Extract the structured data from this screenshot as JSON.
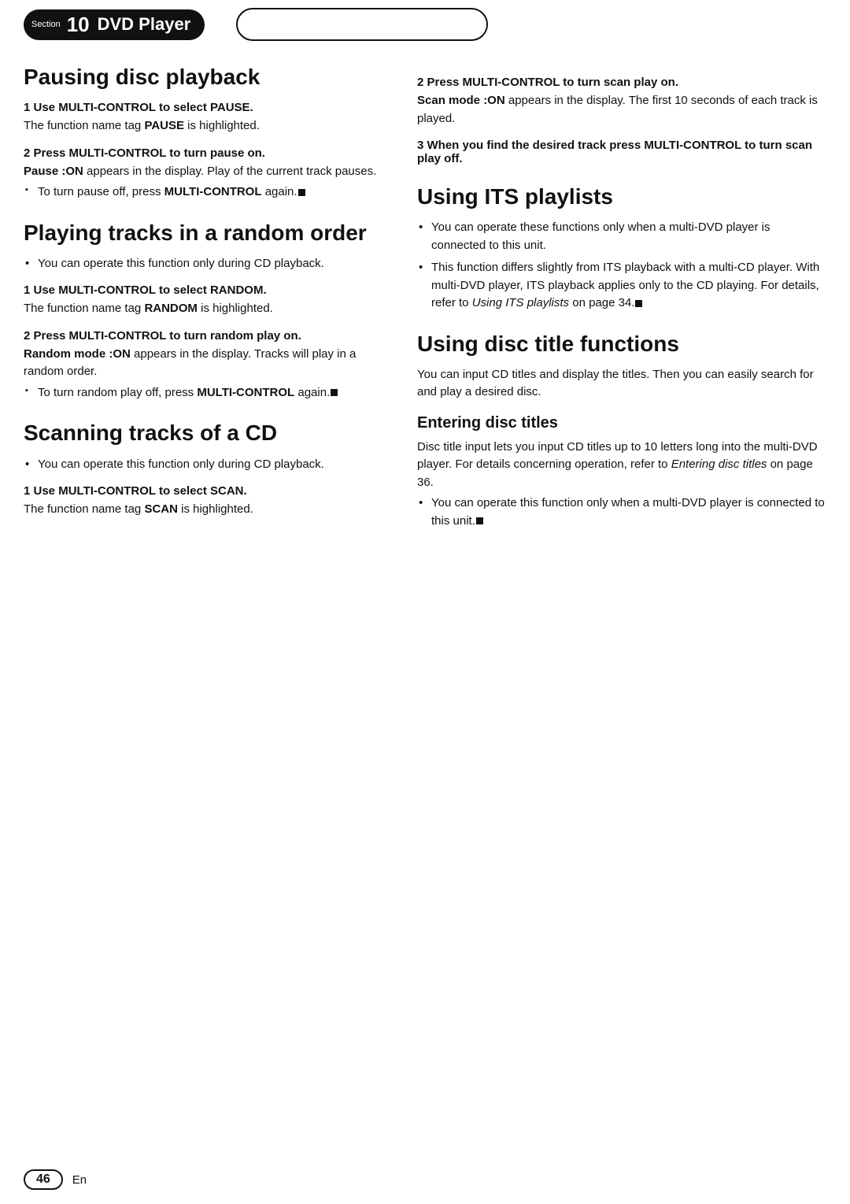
{
  "header": {
    "section_label": "Section",
    "section_number": "10",
    "section_title": "DVD Player"
  },
  "page_number": "46",
  "page_lang": "En",
  "left_col": {
    "pausing": {
      "title": "Pausing disc playback",
      "step1_heading": "1   Use MULTI-CONTROL to select PAUSE.",
      "step1_body": "The function name tag ",
      "step1_bold": "PAUSE",
      "step1_body2": " is highlighted.",
      "step2_heading": "2   Press MULTI-CONTROL to turn pause on.",
      "step2_body1_pre": "",
      "step2_pause_on": "Pause :ON",
      "step2_body1_post": " appears in the display. Play of the current track pauses.",
      "step2_arrow": "To turn pause off, press ",
      "step2_arrow_bold": "MULTI-CONTROL",
      "step2_arrow_post": " again."
    },
    "random": {
      "title": "Playing tracks in a random order",
      "bullets": [
        "You can operate this function only during CD playback."
      ],
      "step1_heading": "1   Use MULTI-CONTROL to select RANDOM.",
      "step1_body_pre": "The function name tag ",
      "step1_body_bold": "RANDOM",
      "step1_body_post": " is highlighted.",
      "step2_heading": "2   Press MULTI-CONTROL to turn random play on.",
      "step2_body1_pre": "",
      "step2_random_on": "Random mode :ON",
      "step2_body1_post": " appears in the display. Tracks will play in a random order.",
      "step2_arrow": "To turn random play off, press ",
      "step2_arrow_bold": "MULTI-CONTROL",
      "step2_arrow_post": " again."
    },
    "scanning": {
      "title": "Scanning tracks of a CD",
      "bullets": [
        "You can operate this function only during CD playback."
      ],
      "step1_heading": "1   Use MULTI-CONTROL to select SCAN.",
      "step1_body_pre": "The function name tag ",
      "step1_body_bold": "SCAN",
      "step1_body_post": " is highlighted."
    }
  },
  "right_col": {
    "scan_continued": {
      "step2_heading": "2   Press MULTI-CONTROL to turn scan play on.",
      "step2_body1_pre": "",
      "step2_scan_on": "Scan mode :ON",
      "step2_body1_post": " appears in the display. The first 10 seconds of each track is played.",
      "step3_heading": "3   When you find the desired track press MULTI-CONTROL to turn scan play off."
    },
    "its": {
      "title": "Using ITS playlists",
      "bullets": [
        "You can operate these functions only when a multi-DVD player is connected to this unit.",
        "This function differs slightly from ITS playback with a multi-CD player. With multi-DVD player, ITS playback applies only to the CD playing. For details, refer to Using ITS playlists on page 34."
      ],
      "its_italic": "Using ITS playlists",
      "its_page": "on page 34."
    },
    "disc_title": {
      "title": "Using disc title functions",
      "body": "You can input CD titles and display the titles. Then you can easily search for and play a desired disc.",
      "entering_title": "Entering disc titles",
      "entering_body_pre": "Disc title input lets you input CD titles up to 10 letters long into the multi-DVD player. For details concerning operation, refer to ",
      "entering_italic": "Entering disc titles",
      "entering_body_post": " on page 36.",
      "bullets": [
        "You can operate this function only when a multi-DVD player is connected to this unit."
      ]
    }
  }
}
